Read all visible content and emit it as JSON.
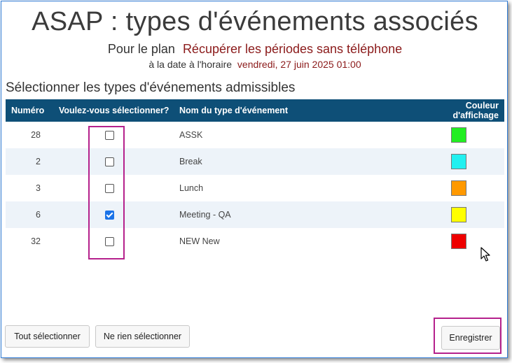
{
  "header": {
    "title": "ASAP : types d'événements associés",
    "plan_label": "Pour le plan",
    "plan_value": "Récupérer les périodes sans téléphone",
    "date_label": "à la date à l'horaire",
    "date_value": "vendredi, 27 juin 2025 01:00"
  },
  "section": {
    "title": "Sélectionner les types d'événements admissibles"
  },
  "table": {
    "headers": {
      "number": "Numéro",
      "select": "Voulez-vous sélectionner?",
      "name": "Nom du type d'événement",
      "color": "Couleur d'affichage"
    },
    "rows": [
      {
        "number": "28",
        "checked": false,
        "name": "ASSK",
        "color": "#22ee22"
      },
      {
        "number": "2",
        "checked": false,
        "name": "Break",
        "color": "#22f0f0"
      },
      {
        "number": "3",
        "checked": false,
        "name": "Lunch",
        "color": "#ff9900"
      },
      {
        "number": "6",
        "checked": true,
        "name": "Meeting - QA",
        "color": "#ffff00"
      },
      {
        "number": "32",
        "checked": false,
        "name": "NEW New",
        "color": "#ee0000"
      }
    ]
  },
  "buttons": {
    "select_all": "Tout sélectionner",
    "select_none": "Ne rien sélectionner",
    "save": "Enregistrer"
  }
}
